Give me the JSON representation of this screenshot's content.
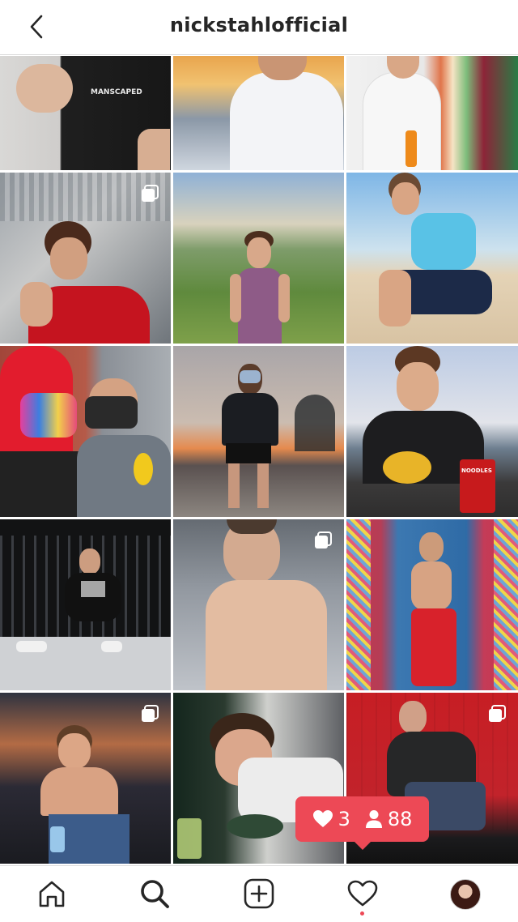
{
  "header": {
    "title": "nickstahlofficial",
    "back_icon": "chevron-left-icon"
  },
  "grid": {
    "tiles": [
      {
        "id": "post-1",
        "multi": false,
        "alt": "MANSCAPED"
      },
      {
        "id": "post-2",
        "multi": false
      },
      {
        "id": "post-3",
        "multi": false
      },
      {
        "id": "post-4",
        "multi": true
      },
      {
        "id": "post-5",
        "multi": false
      },
      {
        "id": "post-6",
        "multi": false
      },
      {
        "id": "post-7",
        "multi": false
      },
      {
        "id": "post-8",
        "multi": false
      },
      {
        "id": "post-9",
        "multi": false,
        "alt": "NOODLES"
      },
      {
        "id": "post-10",
        "multi": false
      },
      {
        "id": "post-11",
        "multi": true
      },
      {
        "id": "post-12",
        "multi": false
      },
      {
        "id": "post-13",
        "multi": true
      },
      {
        "id": "post-14",
        "multi": false
      },
      {
        "id": "post-15",
        "multi": true
      }
    ]
  },
  "activity_tooltip": {
    "likes": "3",
    "follows": "88",
    "color": "#ed4956"
  },
  "tabbar": {
    "items": [
      {
        "name": "home",
        "icon": "home-icon"
      },
      {
        "name": "search",
        "icon": "search-icon"
      },
      {
        "name": "new-post",
        "icon": "plus-square-icon"
      },
      {
        "name": "activity",
        "icon": "heart-icon"
      },
      {
        "name": "profile",
        "icon": "avatar"
      }
    ]
  }
}
